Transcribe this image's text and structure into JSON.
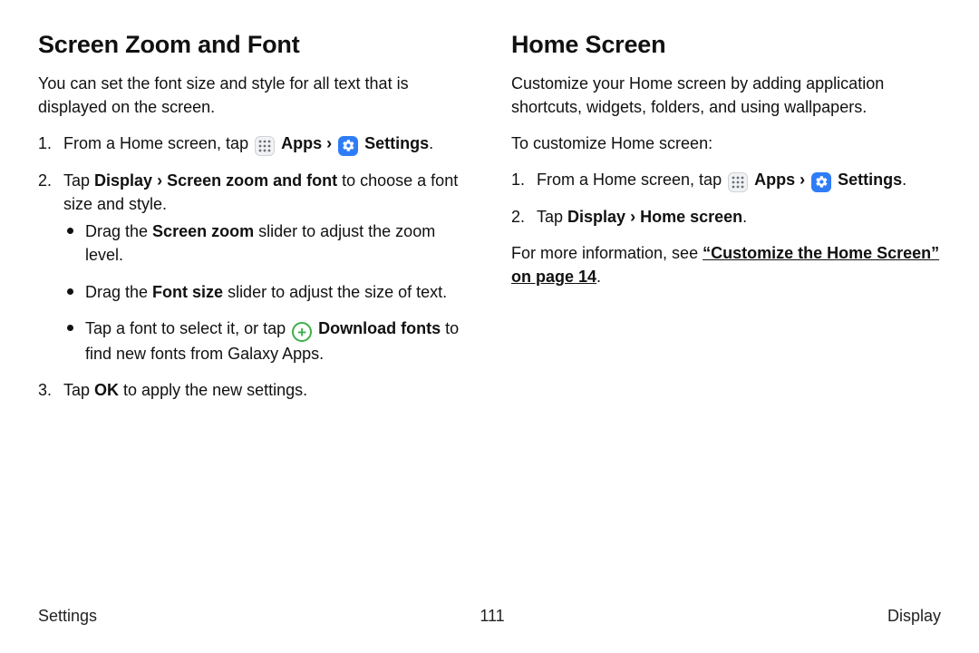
{
  "left": {
    "heading": "Screen Zoom and Font",
    "intro": "You can set the font size and style for all text that is displayed on the screen.",
    "step1_a": "From a Home screen, tap ",
    "apps_label": "Apps",
    "settings_label": "Settings",
    "step1_dot": ".",
    "step2_a": "Tap ",
    "step2_b": "Display",
    "step2_c": "Screen zoom and font",
    "step2_d": " to choose a font size and style.",
    "bullet1_a": "Drag the ",
    "bullet1_b": "Screen zoom",
    "bullet1_c": " slider to adjust the zoom level.",
    "bullet2_a": "Drag the ",
    "bullet2_b": "Font size",
    "bullet2_c": " slider to adjust the size of text.",
    "bullet3_a": "Tap a font to select it, or tap ",
    "bullet3_b": "Download fonts",
    "bullet3_c": " to find new fonts from Galaxy Apps.",
    "step3_a": "Tap ",
    "step3_b": "OK",
    "step3_c": " to apply the new settings.",
    "chev": "›"
  },
  "right": {
    "heading": "Home Screen",
    "intro": "Customize your Home screen by adding application shortcuts, widgets, folders, and using wallpapers.",
    "lead": "To customize Home screen:",
    "step1_a": "From a Home screen, tap ",
    "apps_label": "Apps",
    "settings_label": "Settings",
    "step1_dot": ".",
    "step2_a": "Tap ",
    "step2_b": "Display",
    "step2_c": "Home screen",
    "step2_dot": ".",
    "more_a": "For more information, see ",
    "more_link": "“Customize the Home Screen” on page 14",
    "more_dot": ".",
    "chev": "›"
  },
  "footer": {
    "left": "Settings",
    "center": "111",
    "right": "Display"
  }
}
